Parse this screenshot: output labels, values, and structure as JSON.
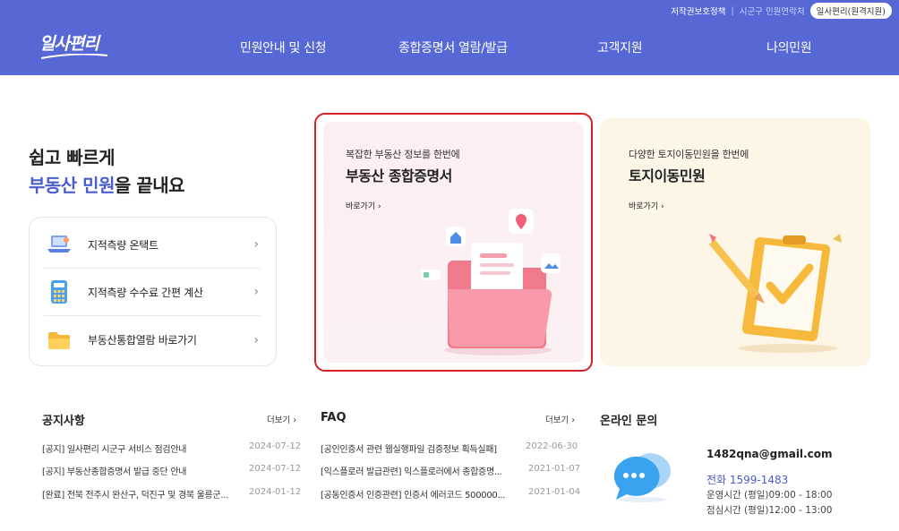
{
  "top_links": {
    "copyright": "저작권보호정책",
    "contact": "시군구 민원연락처",
    "remote": "일사편리(원격지원)"
  },
  "logo": "일사편리",
  "nav": [
    "민원안내 및 신청",
    "종합증명서 열람/발급",
    "고객지원",
    "나의민원"
  ],
  "hero": {
    "line1": "쉽고 빠르게",
    "line2_highlight": "부동산 민원",
    "line2_rest": "을 끝내요"
  },
  "quick_links": [
    {
      "label": "지적측량 온택트",
      "icon": "laptop-icon"
    },
    {
      "label": "지적측량 수수료 간편 계산",
      "icon": "calculator-icon"
    },
    {
      "label": "부동산통합열람 바로가기",
      "icon": "folder-icon"
    }
  ],
  "cards": [
    {
      "sub": "복잡한 부동산 정보를 한번에",
      "title": "부동산 종합증명서",
      "go": "바로가기"
    },
    {
      "sub": "다양한 토지이동민원을 한번에",
      "title": "토지이동민원",
      "go": "바로가기"
    }
  ],
  "notice": {
    "title": "공지사항",
    "more": "더보기",
    "items": [
      {
        "text": "[공지] 일사편리 시군구 서비스 점검안내",
        "date": "2024-07-12"
      },
      {
        "text": "[공지] 부동산종합증명서 발급 중단 안내",
        "date": "2024-07-12"
      },
      {
        "text": "[완료] 전북 전주시 완산구, 덕진구 및 경북 울릉군...",
        "date": "2024-01-12"
      }
    ]
  },
  "faq": {
    "title": "FAQ",
    "more": "더보기",
    "items": [
      {
        "text": "[공인인증서 관련 웹실행파일 검증정보 획득실패]",
        "date": "2022-06-30"
      },
      {
        "text": "[익스플로러 발급관련] 익스플로러에서 종합증명...",
        "date": "2021-01-07"
      },
      {
        "text": "[공동인증서 인증관련] 인증서 에러코드 500000...",
        "date": "2021-01-04"
      }
    ]
  },
  "online": {
    "title": "온라인 문의",
    "email": "1482qna@gmail.com",
    "phone": "전화 1599-1483",
    "hours": "운영시간 (평일)09:00 - 18:00",
    "lunch": "점심시간 (평일)12:00 - 13:00"
  }
}
